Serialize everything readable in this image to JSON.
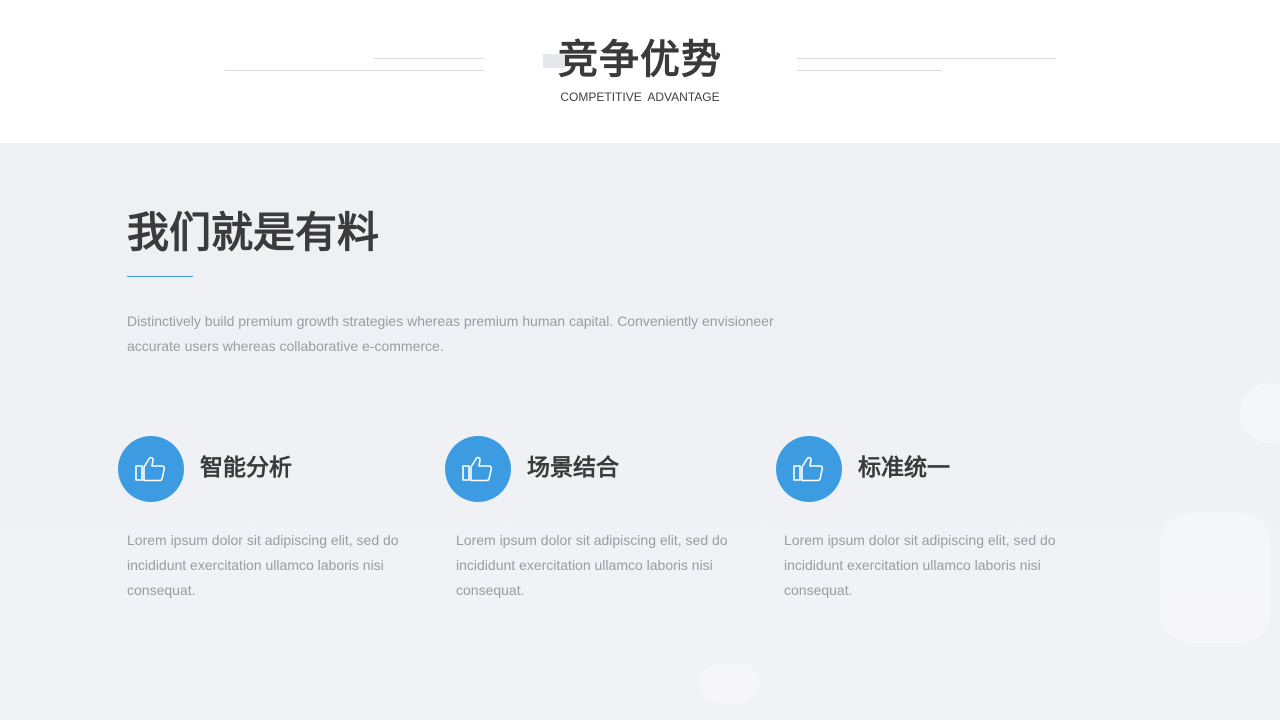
{
  "header": {
    "title": "竞争优势",
    "subtitle": "COMPETITIVE  ADVANTAGE"
  },
  "section": {
    "title": "我们就是有料",
    "intro": "Distinctively build premium growth strategies whereas premium human capital. Conveniently envisioneer accurate users whereas collaborative e-commerce."
  },
  "features": [
    {
      "icon": "thumbs-up-icon",
      "title": "智能分析",
      "description": "Lorem ipsum dolor sit adipiscing elit, sed do incididunt exercitation ullamco laboris nisi consequat."
    },
    {
      "icon": "thumbs-up-icon",
      "title": "场景结合",
      "description": "Lorem ipsum dolor sit adipiscing elit, sed do incididunt exercitation ullamco laboris nisi consequat."
    },
    {
      "icon": "thumbs-up-icon",
      "title": "标准统一",
      "description": "Lorem ipsum dolor sit adipiscing elit, sed do incididunt exercitation ullamco laboris nisi consequat."
    }
  ],
  "colors": {
    "accent": "#3d9be2",
    "heading": "#3b3b3b",
    "body_text": "#9a9ca3",
    "background": "#eef0f4"
  }
}
